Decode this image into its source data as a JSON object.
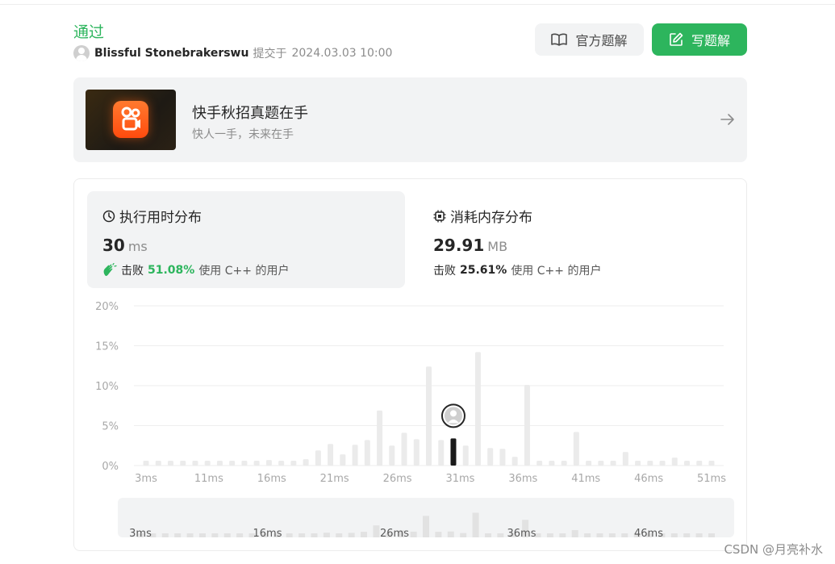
{
  "submission": {
    "status": "通过",
    "username": "Blissful Stonebrakerswu",
    "submitted_text": "提交于",
    "submitted_time": "2024.03.03 10:00"
  },
  "buttons": {
    "official_solution": "官方题解",
    "write_solution": "写题解"
  },
  "banner": {
    "title": "快手秋招真题在手",
    "subtitle": "快人一手，未来在手"
  },
  "runtime": {
    "title": "执行用时分布",
    "value": "30",
    "unit": "ms",
    "beat_label": "击败",
    "beat_pct": "51.08%",
    "beat_suffix": "使用 C++ 的用户"
  },
  "memory": {
    "title": "消耗内存分布",
    "value": "29.91",
    "unit": "MB",
    "beat_label": "击败",
    "beat_pct": "25.61%",
    "beat_suffix": "使用 C++ 的用户"
  },
  "colors": {
    "accent_green": "#2db55d",
    "bar_gray": "#ebebeb",
    "bar_highlight": "#1a1a1a"
  },
  "watermark": "CSDN @月亮补水",
  "chart_data": {
    "type": "bar",
    "ylim": [
      0,
      20
    ],
    "yticks": [
      "20%",
      "15%",
      "10%",
      "5%",
      "0%"
    ],
    "ytick_values": [
      20,
      15,
      10,
      5,
      0
    ],
    "xticks": [
      "3ms",
      "11ms",
      "16ms",
      "21ms",
      "26ms",
      "31ms",
      "36ms",
      "41ms",
      "46ms",
      "51ms"
    ],
    "values": [
      0.6,
      0.6,
      0.6,
      0.6,
      0.6,
      0.6,
      0.6,
      0.6,
      0.6,
      0.6,
      0.7,
      0.6,
      0.6,
      0.8,
      1.9,
      2.7,
      1.4,
      2.6,
      3.2,
      6.9,
      2.5,
      4.1,
      3.3,
      12.4,
      3.2,
      3.4,
      2.5,
      14.2,
      2.2,
      2.1,
      1.1,
      10.1,
      0.6,
      0.6,
      0.6,
      4.2,
      0.6,
      0.6,
      0.6,
      1.7,
      0.6,
      0.6,
      0.6,
      1.0,
      0.6,
      0.6,
      0.6
    ],
    "highlight_index": 25,
    "grid": true,
    "navigator": {
      "xticks": [
        "3ms",
        "16ms",
        "26ms",
        "36ms",
        "46ms"
      ]
    }
  }
}
